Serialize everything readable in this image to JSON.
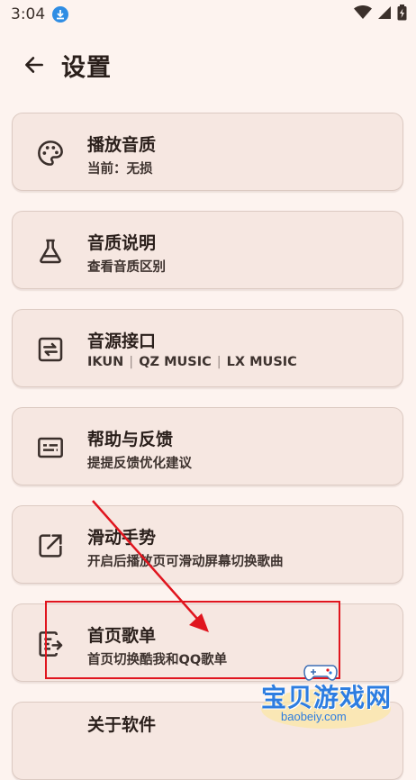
{
  "status": {
    "time": "3:04"
  },
  "header": {
    "title": "设置"
  },
  "items": [
    {
      "icon": "palette-icon",
      "title": "播放音质",
      "subtitle": "当前：无损"
    },
    {
      "icon": "flask-icon",
      "title": "音质说明",
      "subtitle": "查看音质区别"
    },
    {
      "icon": "swap-icon",
      "title": "音源接口",
      "subtitle_parts": [
        "IKUN",
        "QZ MUSIC",
        "LX MUSIC"
      ]
    },
    {
      "icon": "feedback-icon",
      "title": "帮助与反馈",
      "subtitle": "提提反馈优化建议"
    },
    {
      "icon": "open-external-icon",
      "title": "滑动手势",
      "subtitle": "开启后播放页可滑动屏幕切换歌曲"
    },
    {
      "icon": "playlist-export-icon",
      "title": "首页歌单",
      "subtitle": "首页切换酷我和QQ歌单"
    },
    {
      "icon": "",
      "title": "关于软件",
      "subtitle": ""
    }
  ],
  "watermark": {
    "text": "宝贝游戏网",
    "url": "baobeiy.com"
  },
  "colors": {
    "background": "#fdf3ef",
    "card": "#f6e7e1",
    "annotation": "#e0151e",
    "watermark": "#2d7de0"
  }
}
